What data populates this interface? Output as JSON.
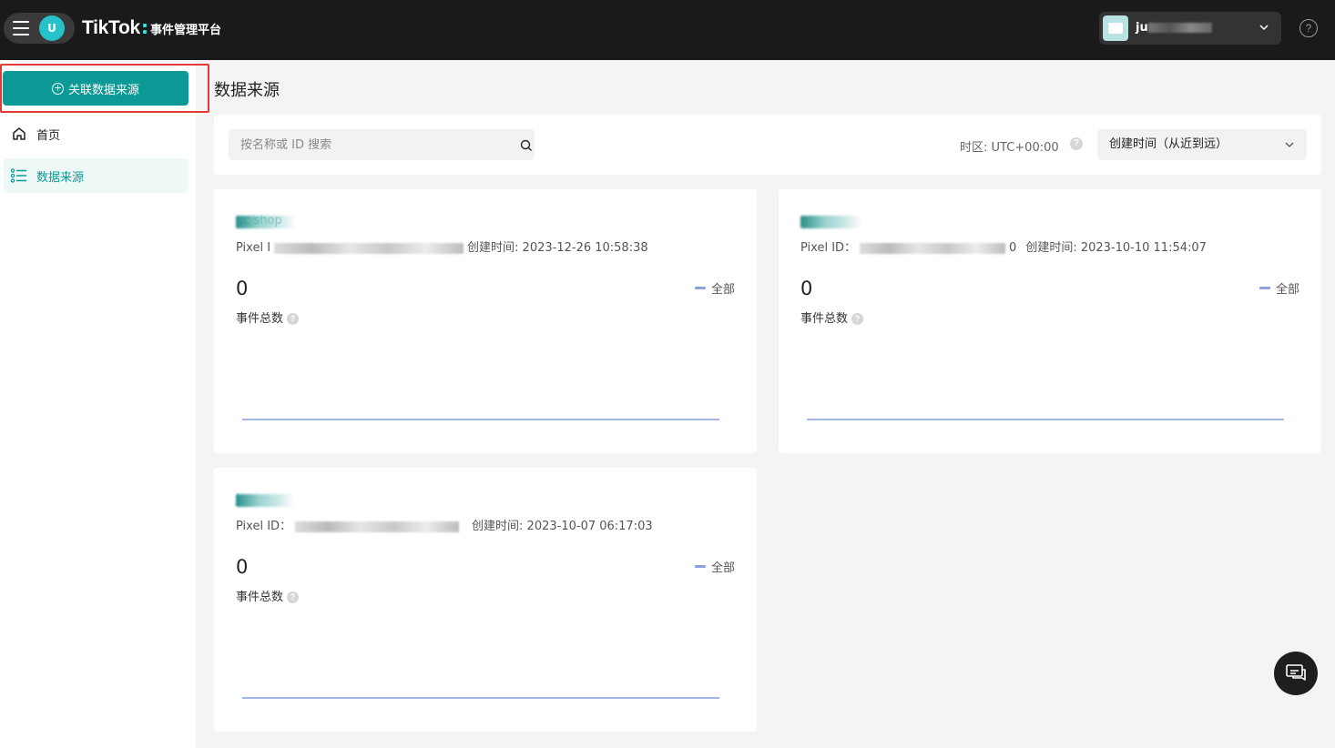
{
  "header": {
    "brand_logo": "TikTok",
    "brand_sep": ":",
    "brand_subtitle": "事件管理平台",
    "avatar_letter": "U",
    "account_name": "ju",
    "help_symbol": "?"
  },
  "sidebar": {
    "connect_button": "关联数据来源",
    "items": [
      {
        "label": "首页",
        "icon": "home-icon"
      },
      {
        "label": "数据来源",
        "icon": "list-icon",
        "active": true
      }
    ]
  },
  "main": {
    "title": "数据来源",
    "search": {
      "placeholder": "按名称或 ID 搜索"
    },
    "timezone_label": "时区: UTC+00:00",
    "sort": {
      "selected": "创建时间（从近到远）"
    },
    "cards": [
      {
        "name": "uc shop",
        "pixel_label": "Pixel I",
        "pixel_suffix": "",
        "created_label": "创建时间: 2023-12-26 10:58:38",
        "count": "0",
        "count_label": "事件总数",
        "legend": "全部"
      },
      {
        "name": "u",
        "pixel_label": "Pixel ID：",
        "pixel_suffix": "0",
        "created_label": "创建时间: 2023-10-10 11:54:07",
        "count": "0",
        "count_label": "事件总数",
        "legend": "全部"
      },
      {
        "name": "J",
        "pixel_label": "Pixel ID：",
        "pixel_suffix": "",
        "created_label": "创建时间: 2023-10-07 06:17:03",
        "count": "0",
        "count_label": "事件总数",
        "legend": "全部"
      }
    ]
  },
  "colors": {
    "accent": "#0d9a96",
    "topbar": "#1a1a1a",
    "highlight": "#e53935",
    "chart_line": "#a4b6e8"
  }
}
